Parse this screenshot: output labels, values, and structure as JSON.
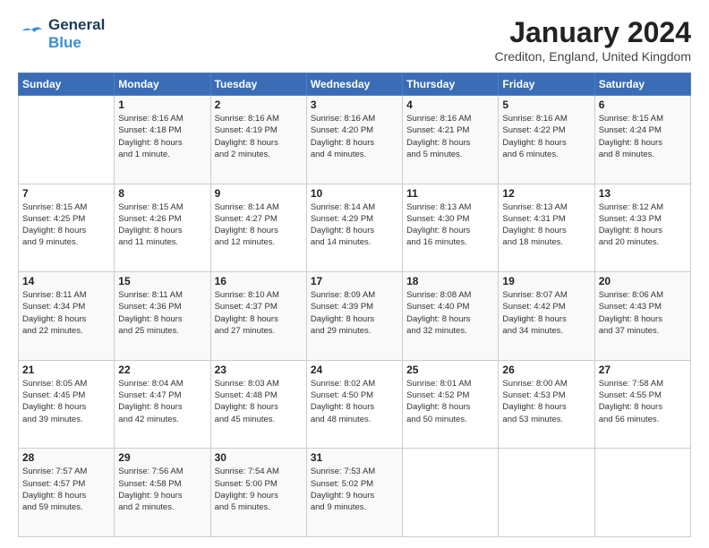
{
  "header": {
    "logo_general": "General",
    "logo_blue": "Blue",
    "main_title": "January 2024",
    "subtitle": "Crediton, England, United Kingdom"
  },
  "calendar": {
    "days_of_week": [
      "Sunday",
      "Monday",
      "Tuesday",
      "Wednesday",
      "Thursday",
      "Friday",
      "Saturday"
    ],
    "weeks": [
      [
        {
          "day": "",
          "info": ""
        },
        {
          "day": "1",
          "info": "Sunrise: 8:16 AM\nSunset: 4:18 PM\nDaylight: 8 hours\nand 1 minute."
        },
        {
          "day": "2",
          "info": "Sunrise: 8:16 AM\nSunset: 4:19 PM\nDaylight: 8 hours\nand 2 minutes."
        },
        {
          "day": "3",
          "info": "Sunrise: 8:16 AM\nSunset: 4:20 PM\nDaylight: 8 hours\nand 4 minutes."
        },
        {
          "day": "4",
          "info": "Sunrise: 8:16 AM\nSunset: 4:21 PM\nDaylight: 8 hours\nand 5 minutes."
        },
        {
          "day": "5",
          "info": "Sunrise: 8:16 AM\nSunset: 4:22 PM\nDaylight: 8 hours\nand 6 minutes."
        },
        {
          "day": "6",
          "info": "Sunrise: 8:15 AM\nSunset: 4:24 PM\nDaylight: 8 hours\nand 8 minutes."
        }
      ],
      [
        {
          "day": "7",
          "info": "Sunrise: 8:15 AM\nSunset: 4:25 PM\nDaylight: 8 hours\nand 9 minutes."
        },
        {
          "day": "8",
          "info": "Sunrise: 8:15 AM\nSunset: 4:26 PM\nDaylight: 8 hours\nand 11 minutes."
        },
        {
          "day": "9",
          "info": "Sunrise: 8:14 AM\nSunset: 4:27 PM\nDaylight: 8 hours\nand 12 minutes."
        },
        {
          "day": "10",
          "info": "Sunrise: 8:14 AM\nSunset: 4:29 PM\nDaylight: 8 hours\nand 14 minutes."
        },
        {
          "day": "11",
          "info": "Sunrise: 8:13 AM\nSunset: 4:30 PM\nDaylight: 8 hours\nand 16 minutes."
        },
        {
          "day": "12",
          "info": "Sunrise: 8:13 AM\nSunset: 4:31 PM\nDaylight: 8 hours\nand 18 minutes."
        },
        {
          "day": "13",
          "info": "Sunrise: 8:12 AM\nSunset: 4:33 PM\nDaylight: 8 hours\nand 20 minutes."
        }
      ],
      [
        {
          "day": "14",
          "info": "Sunrise: 8:11 AM\nSunset: 4:34 PM\nDaylight: 8 hours\nand 22 minutes."
        },
        {
          "day": "15",
          "info": "Sunrise: 8:11 AM\nSunset: 4:36 PM\nDaylight: 8 hours\nand 25 minutes."
        },
        {
          "day": "16",
          "info": "Sunrise: 8:10 AM\nSunset: 4:37 PM\nDaylight: 8 hours\nand 27 minutes."
        },
        {
          "day": "17",
          "info": "Sunrise: 8:09 AM\nSunset: 4:39 PM\nDaylight: 8 hours\nand 29 minutes."
        },
        {
          "day": "18",
          "info": "Sunrise: 8:08 AM\nSunset: 4:40 PM\nDaylight: 8 hours\nand 32 minutes."
        },
        {
          "day": "19",
          "info": "Sunrise: 8:07 AM\nSunset: 4:42 PM\nDaylight: 8 hours\nand 34 minutes."
        },
        {
          "day": "20",
          "info": "Sunrise: 8:06 AM\nSunset: 4:43 PM\nDaylight: 8 hours\nand 37 minutes."
        }
      ],
      [
        {
          "day": "21",
          "info": "Sunrise: 8:05 AM\nSunset: 4:45 PM\nDaylight: 8 hours\nand 39 minutes."
        },
        {
          "day": "22",
          "info": "Sunrise: 8:04 AM\nSunset: 4:47 PM\nDaylight: 8 hours\nand 42 minutes."
        },
        {
          "day": "23",
          "info": "Sunrise: 8:03 AM\nSunset: 4:48 PM\nDaylight: 8 hours\nand 45 minutes."
        },
        {
          "day": "24",
          "info": "Sunrise: 8:02 AM\nSunset: 4:50 PM\nDaylight: 8 hours\nand 48 minutes."
        },
        {
          "day": "25",
          "info": "Sunrise: 8:01 AM\nSunset: 4:52 PM\nDaylight: 8 hours\nand 50 minutes."
        },
        {
          "day": "26",
          "info": "Sunrise: 8:00 AM\nSunset: 4:53 PM\nDaylight: 8 hours\nand 53 minutes."
        },
        {
          "day": "27",
          "info": "Sunrise: 7:58 AM\nSunset: 4:55 PM\nDaylight: 8 hours\nand 56 minutes."
        }
      ],
      [
        {
          "day": "28",
          "info": "Sunrise: 7:57 AM\nSunset: 4:57 PM\nDaylight: 8 hours\nand 59 minutes."
        },
        {
          "day": "29",
          "info": "Sunrise: 7:56 AM\nSunset: 4:58 PM\nDaylight: 9 hours\nand 2 minutes."
        },
        {
          "day": "30",
          "info": "Sunrise: 7:54 AM\nSunset: 5:00 PM\nDaylight: 9 hours\nand 5 minutes."
        },
        {
          "day": "31",
          "info": "Sunrise: 7:53 AM\nSunset: 5:02 PM\nDaylight: 9 hours\nand 9 minutes."
        },
        {
          "day": "",
          "info": ""
        },
        {
          "day": "",
          "info": ""
        },
        {
          "day": "",
          "info": ""
        }
      ]
    ]
  }
}
